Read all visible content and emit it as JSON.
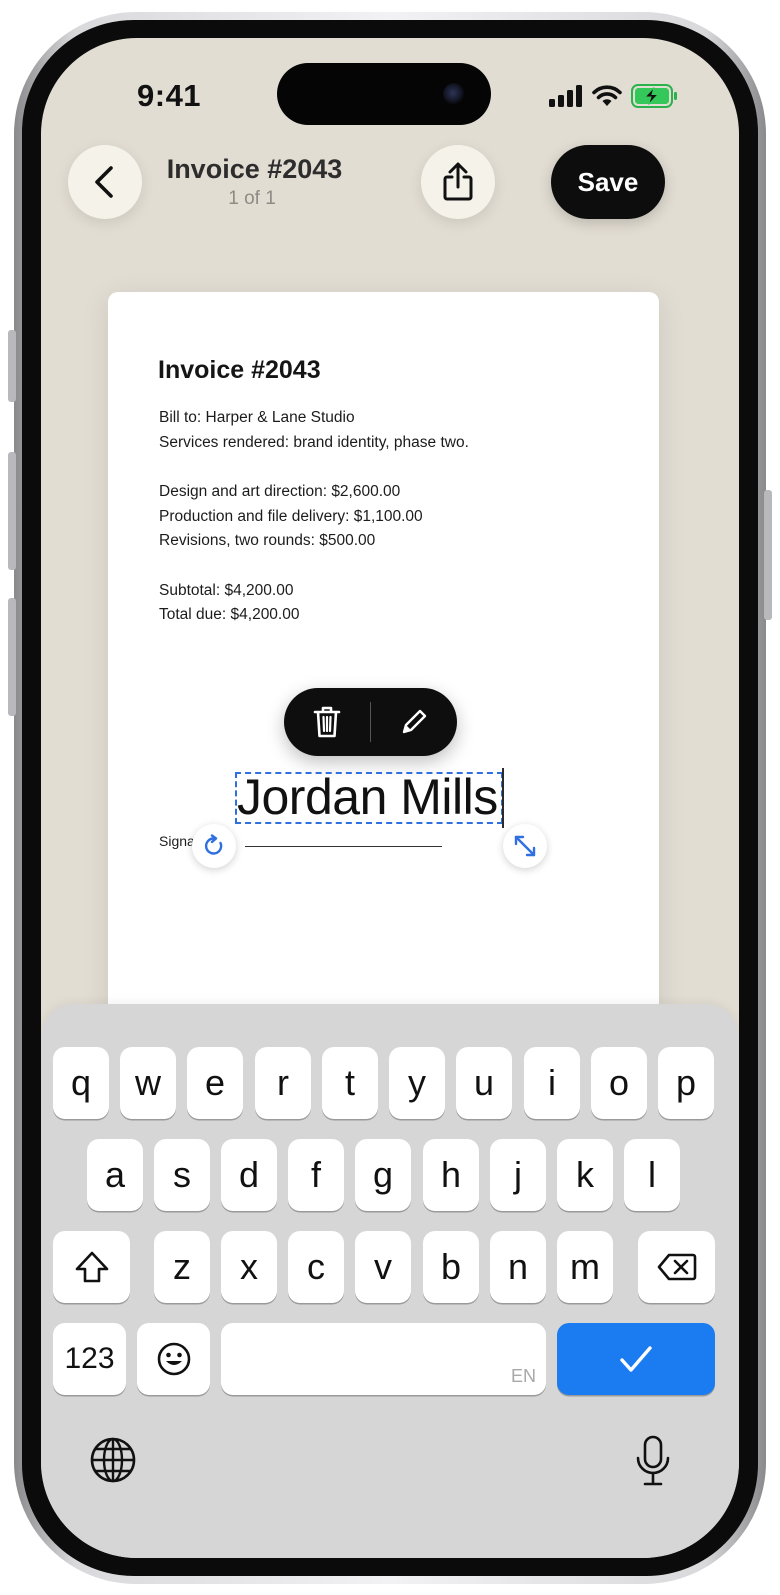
{
  "status_bar": {
    "time": "9:41",
    "icons": [
      "cellular-signal-icon",
      "wifi-icon",
      "battery-charging-icon"
    ]
  },
  "nav": {
    "back_icon": "chevron-left-icon",
    "title": "Invoice #2043",
    "subtitle": "1 of 1",
    "share_icon": "share-icon",
    "save_label": "Save"
  },
  "document": {
    "title": "Invoice #2043",
    "lines": [
      "Bill to: Harper & Lane Studio",
      "Services rendered: brand identity, phase two.",
      "Design and art direction: $2,600.00",
      "Production and file delivery: $1,100.00",
      "Revisions, two rounds: $500.00",
      "Subtotal: $4,200.00",
      "Total due: $4,200.00"
    ],
    "signature_label": "Signa",
    "signature_text": "Jordan Mills"
  },
  "context_menu": {
    "delete_icon": "trash-icon",
    "edit_icon": "pencil-icon"
  },
  "keyboard": {
    "row1": [
      "q",
      "w",
      "e",
      "r",
      "t",
      "y",
      "u",
      "i",
      "o",
      "p"
    ],
    "row2": [
      "a",
      "s",
      "d",
      "f",
      "g",
      "h",
      "j",
      "k",
      "l"
    ],
    "row3": [
      "z",
      "x",
      "c",
      "v",
      "b",
      "n",
      "m"
    ],
    "numbers_label": "123",
    "space_hint": "EN",
    "done_icon": "checkmark-icon",
    "accent_color": "#1a7cf0"
  }
}
